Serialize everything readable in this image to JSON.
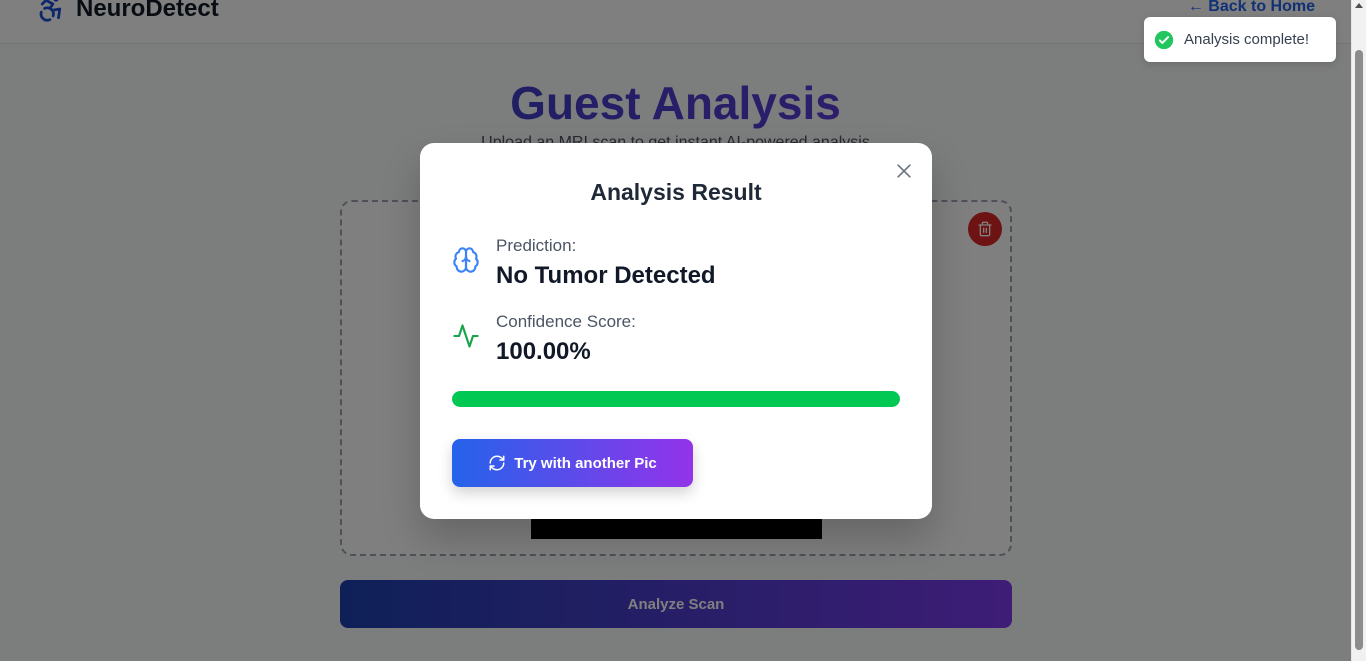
{
  "navbar": {
    "brand": "NeuroDetect",
    "logo_icon": "accessibility-icon",
    "back_link": "← Back to Home"
  },
  "page": {
    "title": "Guest Analysis",
    "subtitle": "Upload an MRI scan to get instant AI-powered analysis",
    "analyze_button": "Analyze Scan",
    "delete_icon": "trash-icon"
  },
  "modal": {
    "title": "Analysis Result",
    "close_icon": "close-icon",
    "prediction": {
      "icon": "brain-icon",
      "label": "Prediction:",
      "value": "No Tumor Detected"
    },
    "confidence": {
      "icon": "activity-icon",
      "label": "Confidence Score:",
      "value": "100.00%",
      "fraction": 1.0
    },
    "retry_button": {
      "icon": "refresh-icon",
      "label": "Try with another Pic"
    }
  },
  "toast": {
    "icon": "check-circle-icon",
    "message": "Analysis complete!"
  },
  "colors": {
    "primary_blue": "#2563eb",
    "accent_purple": "#9333ea",
    "success_green": "#00c853",
    "danger_red": "#dc2626"
  }
}
